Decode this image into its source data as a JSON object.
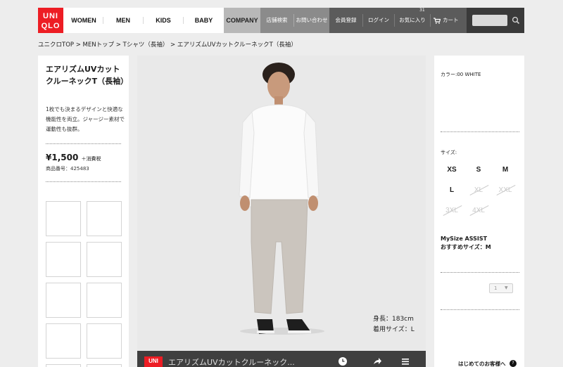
{
  "header": {
    "logo_line1": "UNI",
    "logo_line2": "QLO",
    "nav": [
      "WOMEN",
      "MEN",
      "KIDS",
      "BABY"
    ],
    "company": "COMPANY",
    "store_search": "店舗検索",
    "contact": "お問い合わせ",
    "register": "会員登録",
    "login": "ログイン",
    "favorites": "お気に入り",
    "favorites_count": "31",
    "cart": "カート",
    "search_placeholder": ""
  },
  "breadcrumb": "ユニクロTOP > MENトップ > Tシャツ（長袖） > エアリズムUVカットクルーネックT（長袖）",
  "product": {
    "title": "エアリズムUVカットクルーネックT（長袖）",
    "description": "1枚でも決まるデザインと快適な機能性を両立。ジャージー素材で運動性も抜群。",
    "price": "¥1,500",
    "tax_note": "＋消費税",
    "product_number": "商品番号：425483"
  },
  "model": {
    "height": "身長：183cm",
    "size": "着用サイズ：L"
  },
  "video": {
    "logo": "UNI",
    "title": "エアリズムUVカットクルーネック..."
  },
  "options": {
    "color_label": "カラー:00 WHITE",
    "size_label": "サイズ:",
    "sizes": [
      {
        "label": "XS",
        "available": true
      },
      {
        "label": "S",
        "available": true
      },
      {
        "label": "M",
        "available": true
      },
      {
        "label": "L",
        "available": true
      },
      {
        "label": "XL",
        "available": false
      },
      {
        "label": "XXL",
        "available": false
      },
      {
        "label": "3XL",
        "available": false
      },
      {
        "label": "4XL",
        "available": false
      }
    ],
    "mysize_title": "MySize ASSIST",
    "mysize_recommend": "おすすめサイズ：M",
    "quantity": "1",
    "first_visit": "はじめてのお客様へ",
    "first_visit_badge": "?"
  },
  "colors": {
    "brand": "#ed1d24",
    "company_bg": "#b8b8b8",
    "gray_nav": "#8b8b8b",
    "dark_nav": "#5b5b5b",
    "search_bg": "#3a3a3a"
  }
}
